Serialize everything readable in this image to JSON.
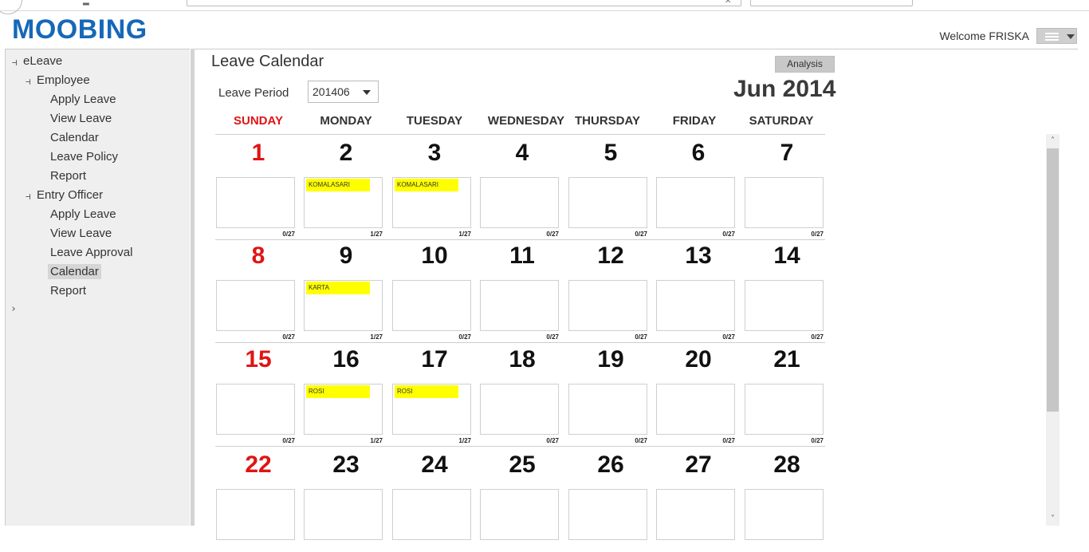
{
  "header": {
    "logo": "MOOBING",
    "welcome": "Welcome FRISKA"
  },
  "sidebar": {
    "root": "eLeave",
    "groups": [
      {
        "label": "Employee",
        "items": [
          "Apply Leave",
          "View Leave",
          "Calendar",
          "Leave Policy",
          "Report"
        ]
      },
      {
        "label": "Entry Officer",
        "items": [
          "Apply Leave",
          "View Leave",
          "Leave Approval",
          "Calendar",
          "Report"
        ]
      }
    ],
    "selected": "Entry Officer / Calendar"
  },
  "main": {
    "title": "Leave Calendar",
    "analysis_label": "Analysis",
    "period_label": "Leave Period",
    "period_value": "201406",
    "month_title": "Jun 2014"
  },
  "calendar": {
    "weekdays": [
      "SUNDAY",
      "MONDAY",
      "TUESDAY",
      "WEDNESDAY",
      "THURSDAY",
      "FRIDAY",
      "SATURDAY"
    ],
    "weeks": [
      [
        {
          "day": "1",
          "names": [],
          "count": "0/27"
        },
        {
          "day": "2",
          "names": [
            "KOMALASARI"
          ],
          "count": "1/27"
        },
        {
          "day": "3",
          "names": [
            "KOMALASARI"
          ],
          "count": "1/27"
        },
        {
          "day": "4",
          "names": [],
          "count": "0/27"
        },
        {
          "day": "5",
          "names": [],
          "count": "0/27"
        },
        {
          "day": "6",
          "names": [],
          "count": "0/27"
        },
        {
          "day": "7",
          "names": [],
          "count": "0/27"
        }
      ],
      [
        {
          "day": "8",
          "names": [],
          "count": "0/27"
        },
        {
          "day": "9",
          "names": [
            "KARTA"
          ],
          "count": "1/27"
        },
        {
          "day": "10",
          "names": [],
          "count": "0/27"
        },
        {
          "day": "11",
          "names": [],
          "count": "0/27"
        },
        {
          "day": "12",
          "names": [],
          "count": "0/27"
        },
        {
          "day": "13",
          "names": [],
          "count": "0/27"
        },
        {
          "day": "14",
          "names": [],
          "count": "0/27"
        }
      ],
      [
        {
          "day": "15",
          "names": [],
          "count": "0/27"
        },
        {
          "day": "16",
          "names": [
            "ROSI"
          ],
          "count": "1/27"
        },
        {
          "day": "17",
          "names": [
            "ROSI"
          ],
          "count": "1/27"
        },
        {
          "day": "18",
          "names": [],
          "count": "0/27"
        },
        {
          "day": "19",
          "names": [],
          "count": "0/27"
        },
        {
          "day": "20",
          "names": [],
          "count": "0/27"
        },
        {
          "day": "21",
          "names": [],
          "count": "0/27"
        }
      ],
      [
        {
          "day": "22",
          "names": [],
          "count": ""
        },
        {
          "day": "23",
          "names": [],
          "count": ""
        },
        {
          "day": "24",
          "names": [],
          "count": ""
        },
        {
          "day": "25",
          "names": [],
          "count": ""
        },
        {
          "day": "26",
          "names": [],
          "count": ""
        },
        {
          "day": "27",
          "names": [],
          "count": ""
        },
        {
          "day": "28",
          "names": [],
          "count": ""
        }
      ]
    ]
  },
  "colors": {
    "brand": "#1668b8",
    "sunday": "#e01414",
    "leave_tag": "#ffff00"
  },
  "icons": {
    "menu": "hamburger-icon",
    "tree_expanded": "tree-minus-icon",
    "tree_collapsed": "chevron-right-icon"
  }
}
